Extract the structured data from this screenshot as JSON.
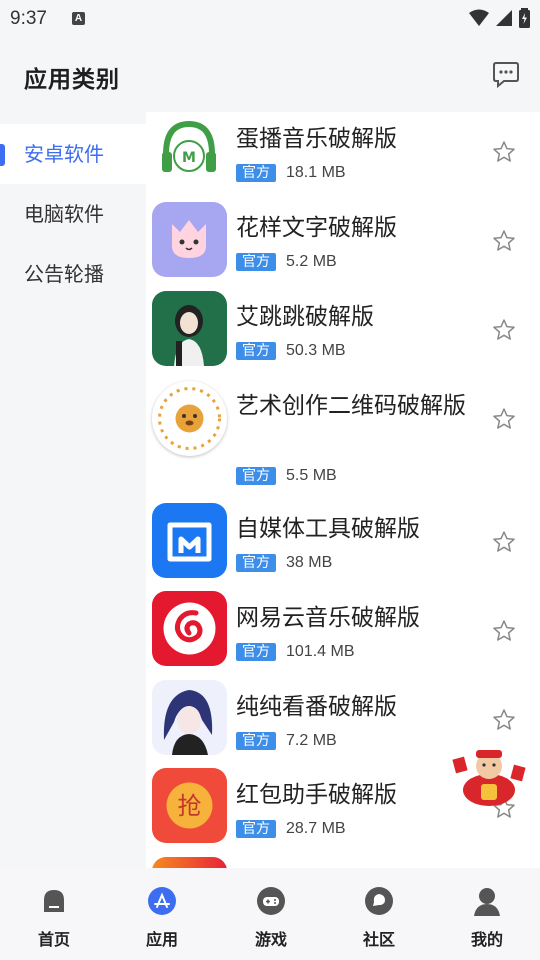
{
  "status": {
    "time": "9:37",
    "a_badge": "A"
  },
  "header": {
    "title": "应用类别",
    "icon": "message-icon"
  },
  "sidebar": {
    "items": [
      {
        "label": "安卓软件",
        "active": true
      },
      {
        "label": "电脑软件",
        "active": false
      },
      {
        "label": "公告轮播",
        "active": false
      }
    ]
  },
  "apps": [
    {
      "name": "蛋播音乐破解版",
      "badge": "官方",
      "size": "18.1 MB",
      "icon": "music-headphones-icon"
    },
    {
      "name": "花样文字破解版",
      "badge": "官方",
      "size": "5.2 MB",
      "icon": "cute-tulip-icon"
    },
    {
      "name": "艾跳跳破解版",
      "badge": "官方",
      "size": "50.3 MB",
      "icon": "girl-portrait-icon"
    },
    {
      "name": "艺术创作二维码破解版",
      "badge": "官方",
      "size": "5.5 MB",
      "icon": "flower-lion-icon"
    },
    {
      "name": "自媒体工具破解版",
      "badge": "官方",
      "size": "38 MB",
      "icon": "store-box-icon"
    },
    {
      "name": "网易云音乐破解版",
      "badge": "官方",
      "size": "101.4 MB",
      "icon": "netease-music-icon"
    },
    {
      "name": "纯纯看番破解版",
      "badge": "官方",
      "size": "7.2 MB",
      "icon": "anime-girl-icon"
    },
    {
      "name": "红包助手破解版",
      "badge": "官方",
      "size": "28.7 MB",
      "icon": "red-envelope-grab-icon",
      "icon_char": "抢"
    }
  ],
  "tabs": [
    {
      "label": "首页",
      "icon": "home-icon"
    },
    {
      "label": "应用",
      "icon": "app-store-icon",
      "active": true
    },
    {
      "label": "游戏",
      "icon": "gamepad-icon"
    },
    {
      "label": "社区",
      "icon": "community-icon"
    },
    {
      "label": "我的",
      "icon": "profile-icon"
    }
  ],
  "colors": {
    "accent": "#3d6df0",
    "badge": "#3d8ee8"
  }
}
